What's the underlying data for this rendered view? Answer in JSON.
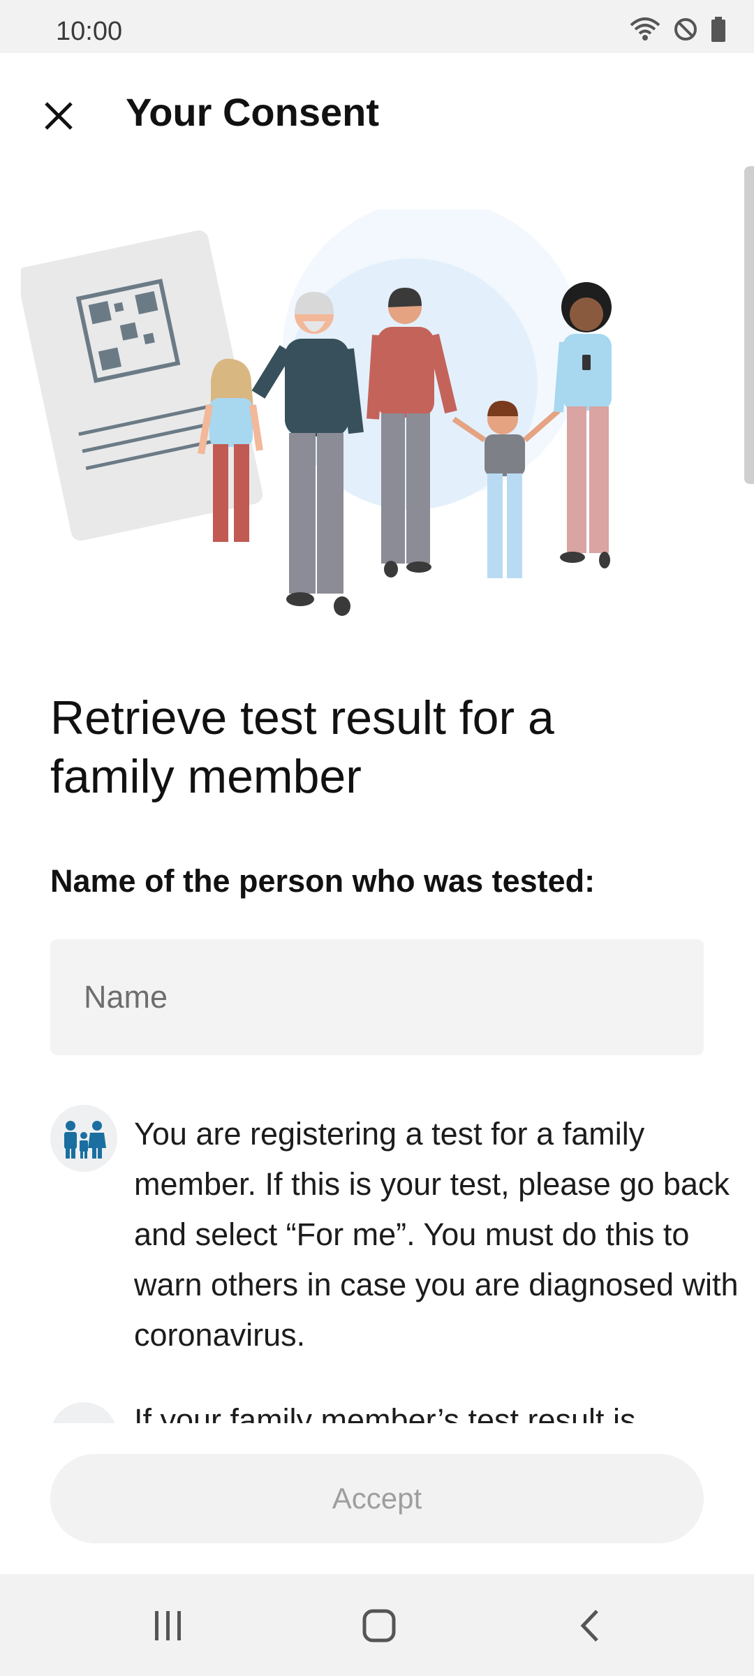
{
  "status_bar": {
    "time": "10:00",
    "icons": [
      "wifi-icon",
      "do-not-disturb-icon",
      "battery-icon"
    ]
  },
  "header": {
    "title": "Your Consent",
    "close_icon": "close-icon"
  },
  "main": {
    "heading": "Retrieve test result for a family member",
    "field_label": "Name of the person who was tested:",
    "name_placeholder": "Name",
    "name_value": "",
    "info": {
      "icon": "family-icon",
      "text": "You are registering a test for a family member. If this is your test, please go back and select “For me”. You must do this to warn others in case you are diagnosed with coronavirus."
    },
    "clipped_text": "If your family member’s test result is"
  },
  "footer": {
    "accept_label": "Accept"
  },
  "navbar": {
    "icons": [
      "recent-apps-icon",
      "home-icon",
      "back-icon"
    ]
  },
  "colors": {
    "accent": "#1a6fa0",
    "disabled_text": "#9e9e9e",
    "surface": "#f2f2f2"
  }
}
